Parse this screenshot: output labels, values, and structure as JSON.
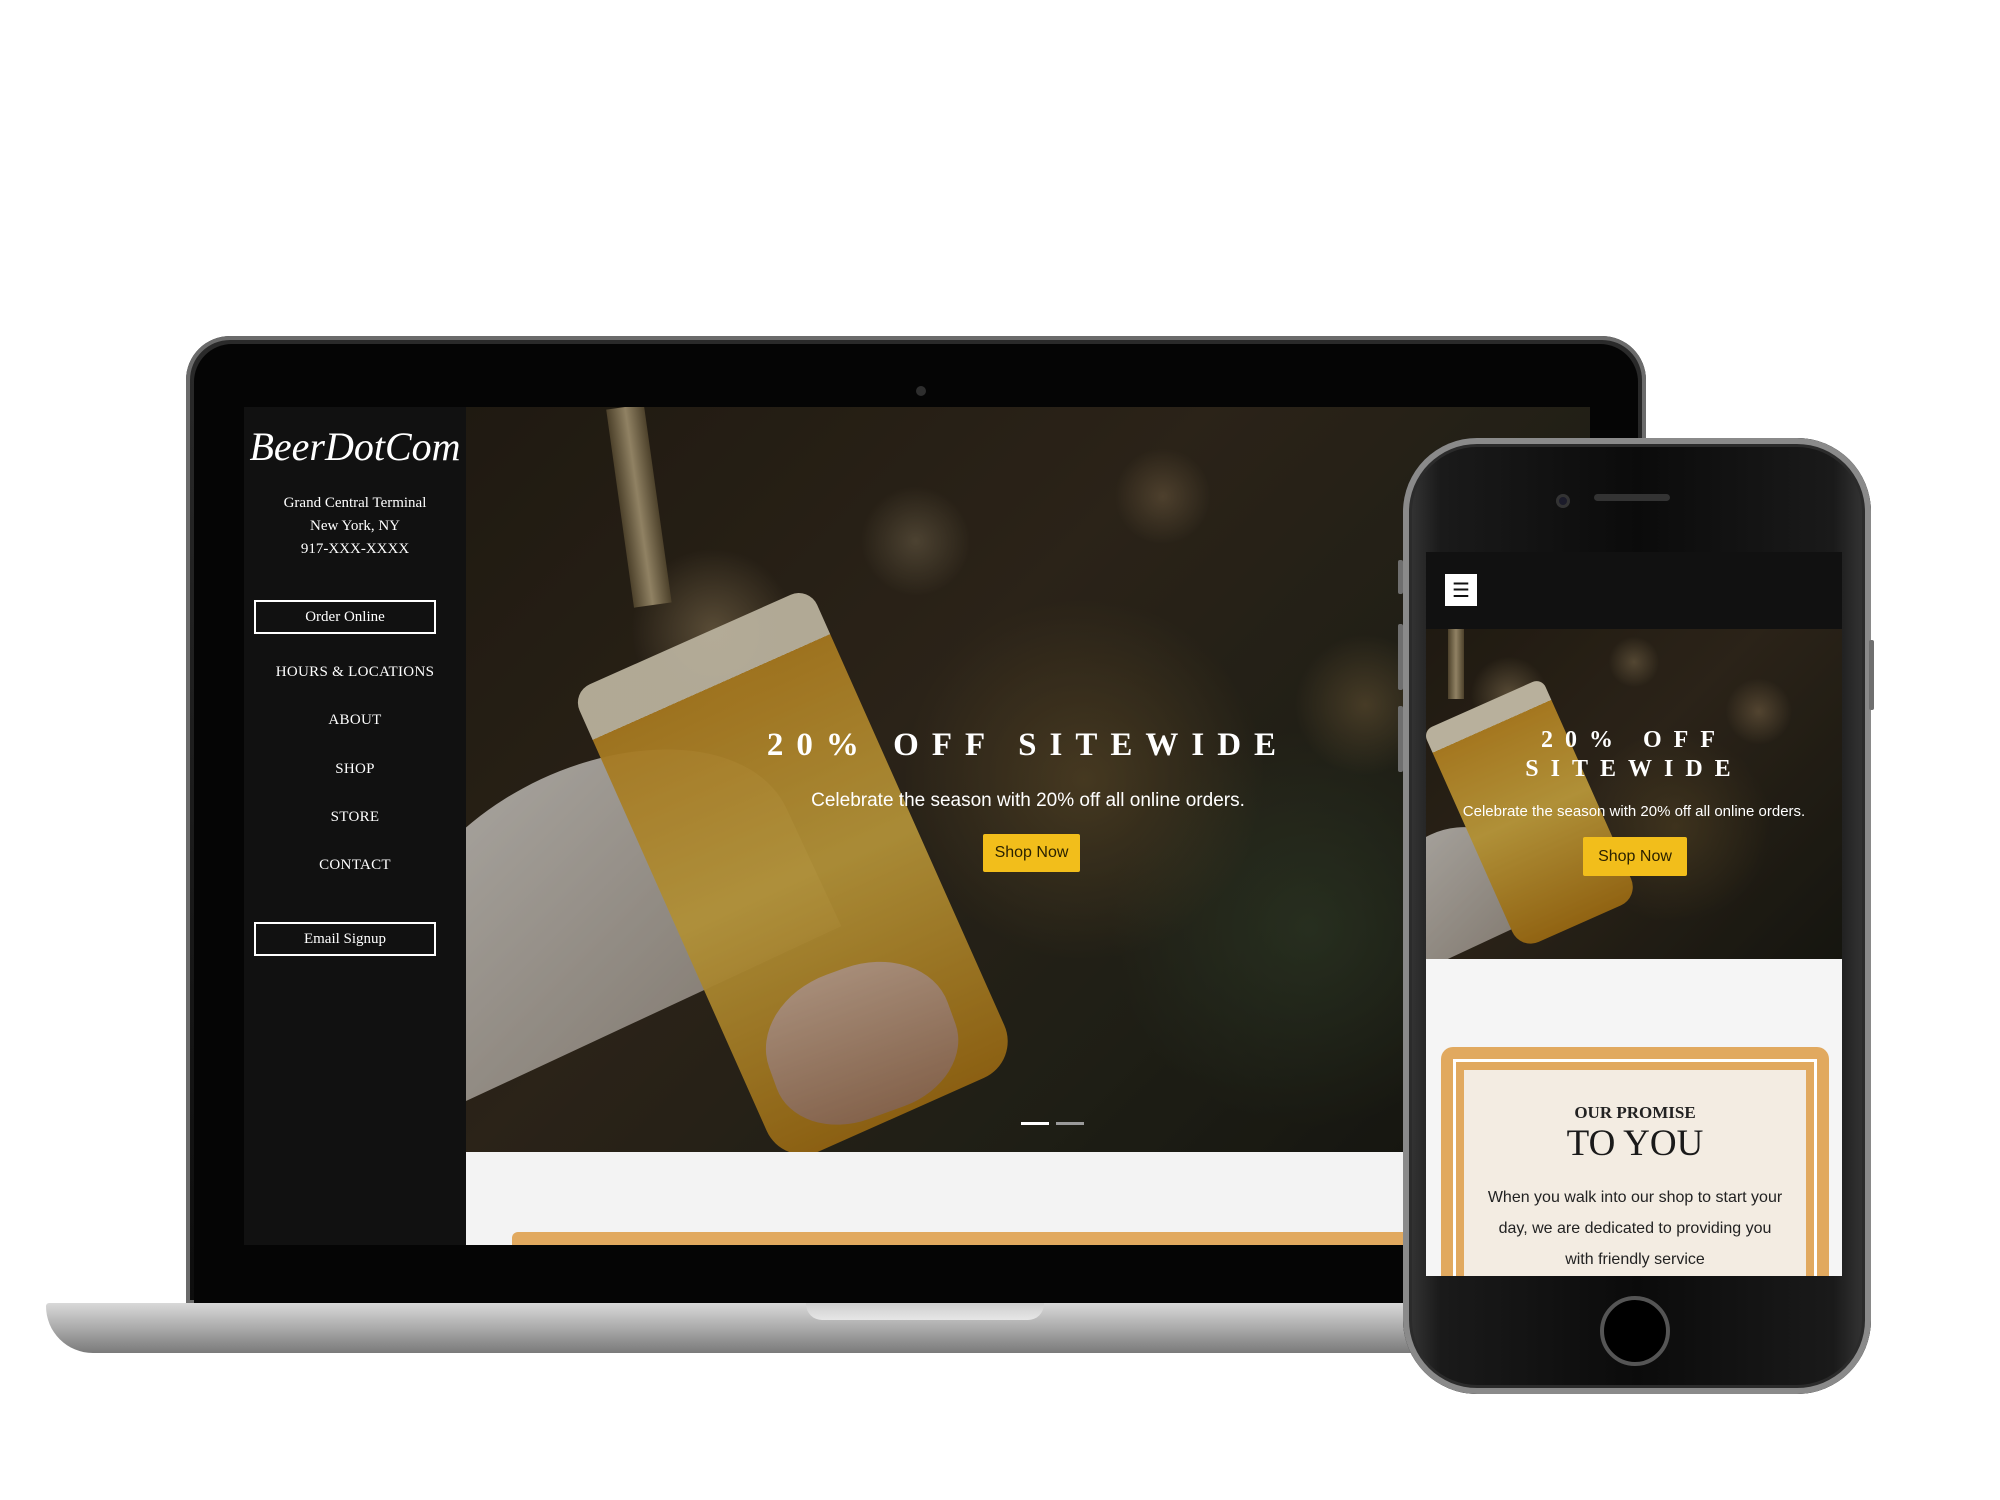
{
  "brand": {
    "logo": "BeerDotCom",
    "address_lines": [
      "Grand Central Terminal",
      "New York, NY",
      "917-XXX-XXXX"
    ]
  },
  "sidebar": {
    "order_button": "Order Online",
    "nav_items": [
      "HOURS & LOCATIONS",
      "ABOUT",
      "SHOP",
      "STORE",
      "CONTACT"
    ],
    "email_button": "Email Signup"
  },
  "hero": {
    "headline": "20% OFF SITEWIDE",
    "subtext": "Celebrate the season with 20% off all online orders.",
    "cta": "Shop Now",
    "slide_count": 2,
    "active_slide": 1
  },
  "mobile": {
    "menu_icon": "☰",
    "headline_lines": [
      "20% OFF",
      "SITEWIDE"
    ],
    "subtext": "Celebrate the season with 20% off all online orders.",
    "cta": "Shop Now",
    "promise": {
      "kicker": "OUR PROMISE",
      "title": "TO YOU",
      "body": "When you walk into our shop to start your day, we are dedicated to providing you with friendly service"
    }
  },
  "colors": {
    "accent": "#f2be1b",
    "promise_border": "#e1a95f",
    "sidebar_bg": "#111111"
  }
}
